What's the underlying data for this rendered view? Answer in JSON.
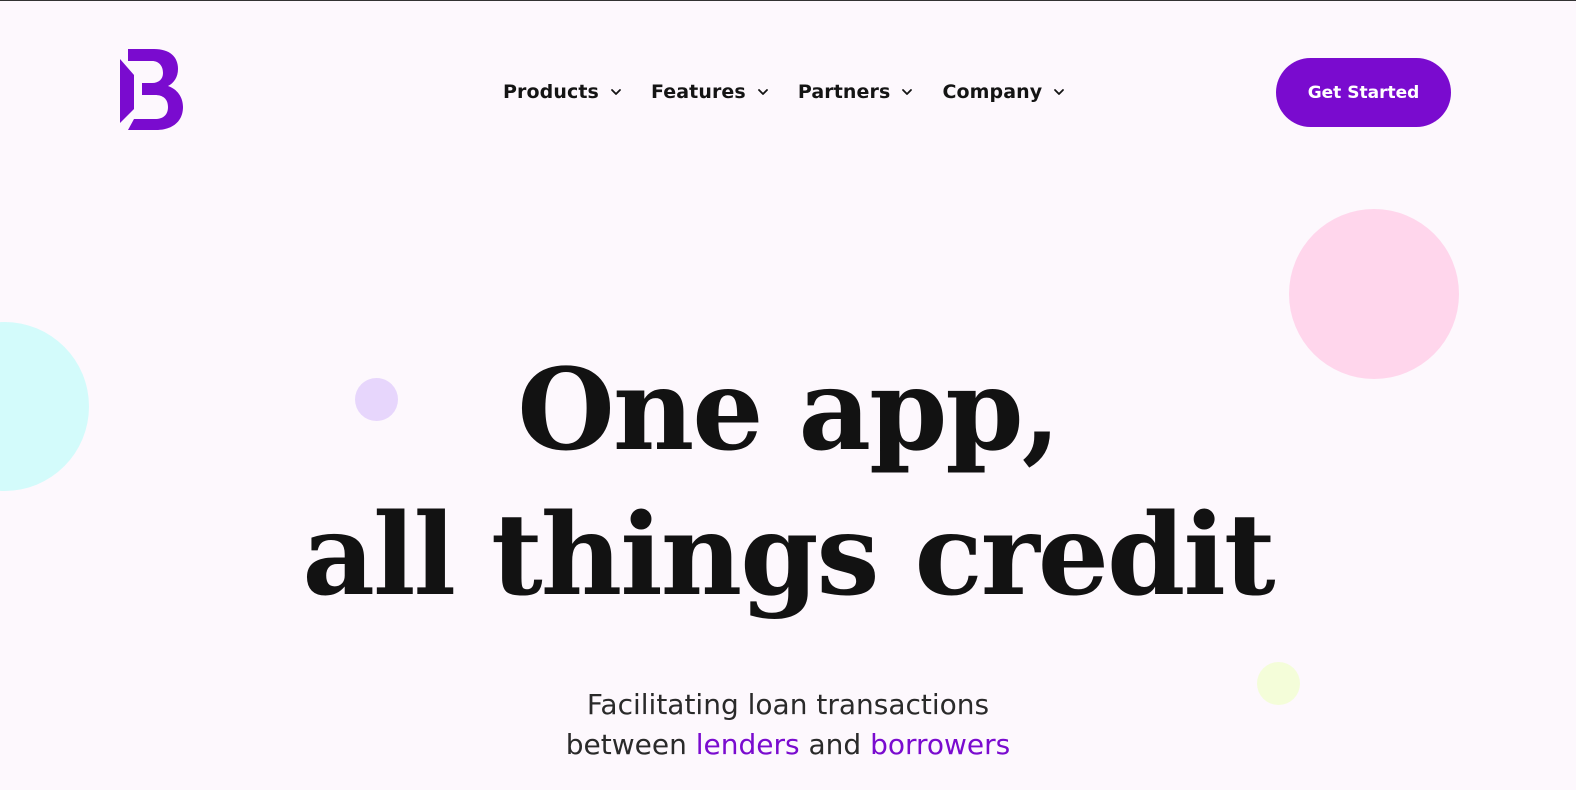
{
  "brand": {
    "logo_icon": "b-logo-icon",
    "accent_color": "#7a0bcf"
  },
  "nav": {
    "items": [
      {
        "label": "Products",
        "icon": "chevron-down-icon"
      },
      {
        "label": "Features",
        "icon": "chevron-down-icon"
      },
      {
        "label": "Partners",
        "icon": "chevron-down-icon"
      },
      {
        "label": "Company",
        "icon": "chevron-down-icon"
      }
    ]
  },
  "cta": {
    "label": "Get Started",
    "color": "#7a0bcf"
  },
  "hero": {
    "headline_line1": "One app,",
    "headline_line2": "all things credit",
    "subtitle_line1": "Facilitating loan transactions",
    "subtitle_between": "between ",
    "subtitle_lenders": "lenders",
    "subtitle_and": " and ",
    "subtitle_borrowers": "borrowers"
  },
  "decorations": {
    "circle_colors": [
      "#d3fbfb",
      "#e7d6fc",
      "#ffd6ec",
      "#f4fdd9"
    ]
  }
}
